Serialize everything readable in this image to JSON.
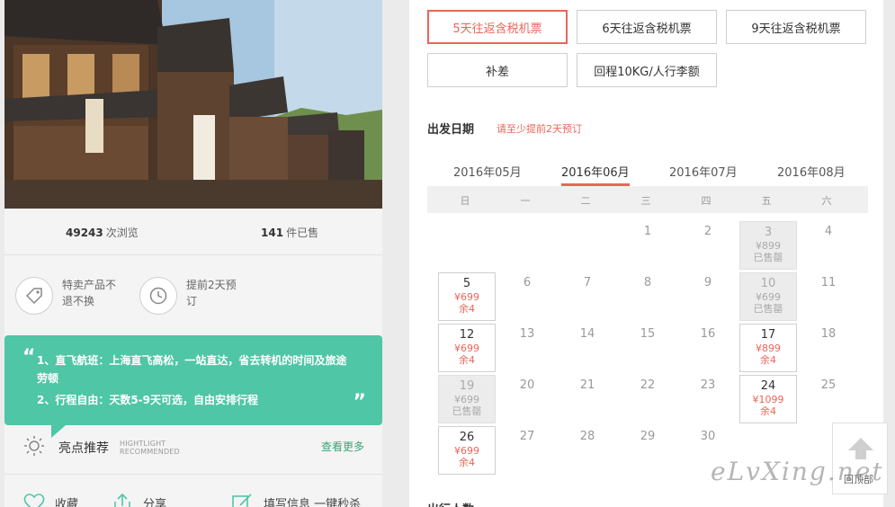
{
  "stats": {
    "views_count": "49243",
    "views_label": "次浏览",
    "sold_count": "141",
    "sold_label": "件已售"
  },
  "features": [
    {
      "icon": "tag-icon",
      "text": "特卖产品不退不换"
    },
    {
      "icon": "clock-icon",
      "text": "提前2天预订"
    }
  ],
  "highlights": {
    "line1": "1、直飞航班：上海直飞高松，一站直达，省去转机的时间及旅途劳顿",
    "line2": "2、行程自由：天数5-9天可选，自由安排行程",
    "open_quote": "“",
    "close_quote": "”"
  },
  "recommend": {
    "title": "亮点推荐",
    "en_line1": "HIGHTLIGHT",
    "en_line2": "RECOMMENDED",
    "more": "查看更多"
  },
  "actions": {
    "favorite": "收藏",
    "share": "分享",
    "fill_info": "填写信息 一键秒杀"
  },
  "options": [
    {
      "label": "5天往返含税机票",
      "selected": true
    },
    {
      "label": "6天往返含税机票",
      "selected": false
    },
    {
      "label": "9天往返含税机票",
      "selected": false
    },
    {
      "label": "补差",
      "selected": false
    },
    {
      "label": "回程10KG/人行李额",
      "selected": false
    }
  ],
  "departure": {
    "label": "出发日期",
    "note": "请至少提前2天预订"
  },
  "months": [
    "2016年05月",
    "2016年06月",
    "2016年07月",
    "2016年08月"
  ],
  "active_month": "2016年06月",
  "weekdays": [
    "日",
    "一",
    "二",
    "三",
    "四",
    "五",
    "六"
  ],
  "calendar": {
    "d1": "1",
    "d2": "2",
    "d3": {
      "num": "3",
      "price": "¥899",
      "status": "已售罄"
    },
    "d4": "4",
    "d5": {
      "num": "5",
      "price": "¥699",
      "status": "余4"
    },
    "d6": "6",
    "d7": "7",
    "d8": "8",
    "d9": "9",
    "d10": {
      "num": "10",
      "price": "¥699",
      "status": "已售罄"
    },
    "d11": "11",
    "d12": {
      "num": "12",
      "price": "¥699",
      "status": "余4"
    },
    "d13": "13",
    "d14": "14",
    "d15": "15",
    "d16": "16",
    "d17": {
      "num": "17",
      "price": "¥899",
      "status": "余4"
    },
    "d18": "18",
    "d19": {
      "num": "19",
      "price": "¥699",
      "status": "已售罄"
    },
    "d20": "20",
    "d21": "21",
    "d22": "22",
    "d23": "23",
    "d24": {
      "num": "24",
      "price": "¥1099",
      "status": "余4"
    },
    "d25": "25",
    "d26": {
      "num": "26",
      "price": "¥699",
      "status": "余4"
    },
    "d27": "27",
    "d28": "28",
    "d29": "29",
    "d30": "30"
  },
  "travelers_label": "出行人数",
  "back_to_top": "回顶部",
  "watermark": "eLvXing.net",
  "colors": {
    "accent": "#e8665a",
    "highlight_green": "#4fc6a6",
    "link_green": "#3aa57a"
  }
}
